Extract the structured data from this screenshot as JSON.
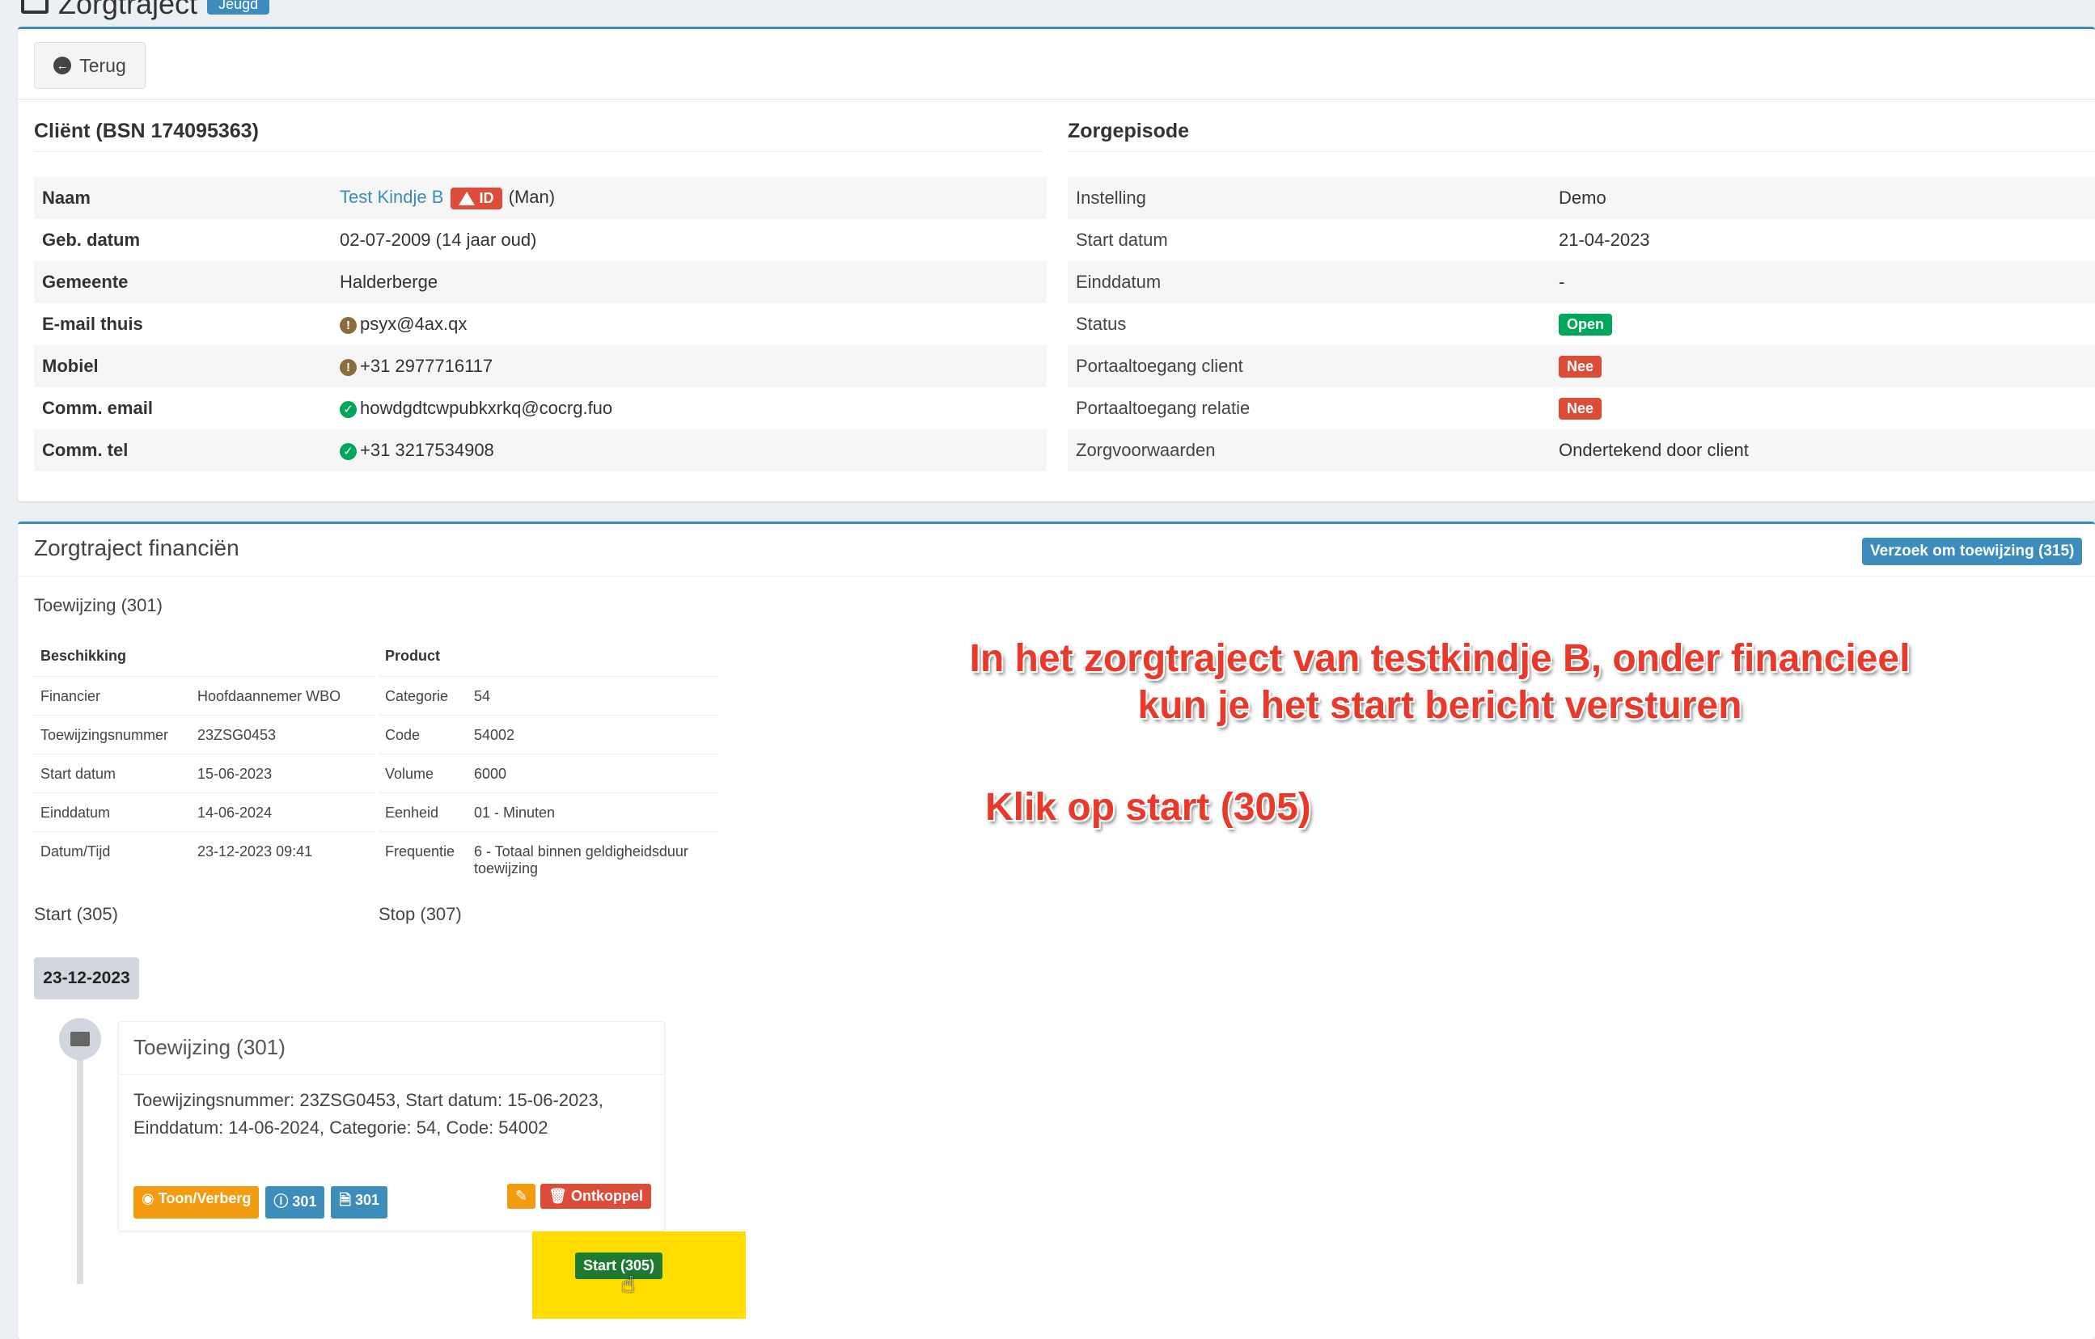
{
  "page": {
    "title": "Zorgtraject",
    "title_badge": "Jeugd"
  },
  "header": {
    "back_label": "Terug"
  },
  "client": {
    "section_title": "Cliënt (BSN 174095363)",
    "rows": [
      {
        "label": "Naam",
        "value": "Test Kindje B",
        "badge": "ID",
        "suffix": "(Man)"
      },
      {
        "label": "Geb. datum",
        "value": "02-07-2009 (14 jaar oud)"
      },
      {
        "label": "Gemeente",
        "value": "Halderberge"
      },
      {
        "label": "E-mail thuis",
        "value": "psyx@4ax.qx"
      },
      {
        "label": "Mobiel",
        "value": "+31 2977716117"
      },
      {
        "label": "Comm. email",
        "value": "howdgdtcwpubkxrkq@cocrg.fuo"
      },
      {
        "label": "Comm. tel",
        "value": "+31 3217534908"
      }
    ]
  },
  "zorgepisode": {
    "section_title": "Zorgepisode",
    "rows": [
      {
        "label": "Instelling",
        "value": "Demo"
      },
      {
        "label": "Start datum",
        "value": "21-04-2023"
      },
      {
        "label": "Einddatum",
        "value": "-"
      },
      {
        "label": "Status",
        "value": "Open"
      },
      {
        "label": "Portaaltoegang client",
        "value": "Nee"
      },
      {
        "label": "Portaaltoegang relatie",
        "value": "Nee"
      },
      {
        "label": "Zorgvoorwaarden",
        "value": "Ondertekend door client"
      }
    ]
  },
  "financien": {
    "title": "Zorgtraject financiën",
    "request_button": "Verzoek om toewijzing (315)",
    "toewijzing_label": "Toewijzing (301)",
    "beschikking": {
      "header": "Beschikking",
      "rows": [
        {
          "label": "Financier",
          "value": "Hoofdaannemer WBO"
        },
        {
          "label": "Toewijzingsnummer",
          "value": "23ZSG0453"
        },
        {
          "label": "Start datum",
          "value": "15-06-2023"
        },
        {
          "label": "Einddatum",
          "value": "14-06-2024"
        },
        {
          "label": "Datum/Tijd",
          "value": "23-12-2023 09:41"
        }
      ]
    },
    "product": {
      "header": "Product",
      "rows": [
        {
          "label": "Categorie",
          "value": "54"
        },
        {
          "label": "Code",
          "value": "54002"
        },
        {
          "label": "Volume",
          "value": "6000"
        },
        {
          "label": "Eenheid",
          "value": "01 - Minuten"
        },
        {
          "label": "Frequentie",
          "value": "6 - Totaal binnen geldigheidsduur toewijzing"
        }
      ]
    },
    "start_label": "Start (305)",
    "stop_label": "Stop (307)",
    "timeline": {
      "date": "23-12-2023",
      "item_title": "Toewijzing (301)",
      "item_body": "Toewijzingsnummer: 23ZSG0453, Start datum: 15-06-2023, Einddatum: 14-06-2024, Categorie: 54, Code: 54002",
      "btn_toggle": "Toon/Verberg",
      "btn_info": "301",
      "btn_pdf": "301",
      "btn_unlink": "Ontkoppel",
      "btn_start": "Start (305)"
    }
  },
  "annotations": {
    "line1": "In het zorgtraject van testkindje B, onder financieel",
    "line2": "kun je het start bericht versturen",
    "click_hint": "Klik op start (305)"
  },
  "colors": {
    "primary": "#3c8dbc",
    "success": "#00a65a",
    "danger": "#dd4b39",
    "warning": "#f39c12",
    "annotation": "#e8392b",
    "highlight": "#ffdd00"
  }
}
